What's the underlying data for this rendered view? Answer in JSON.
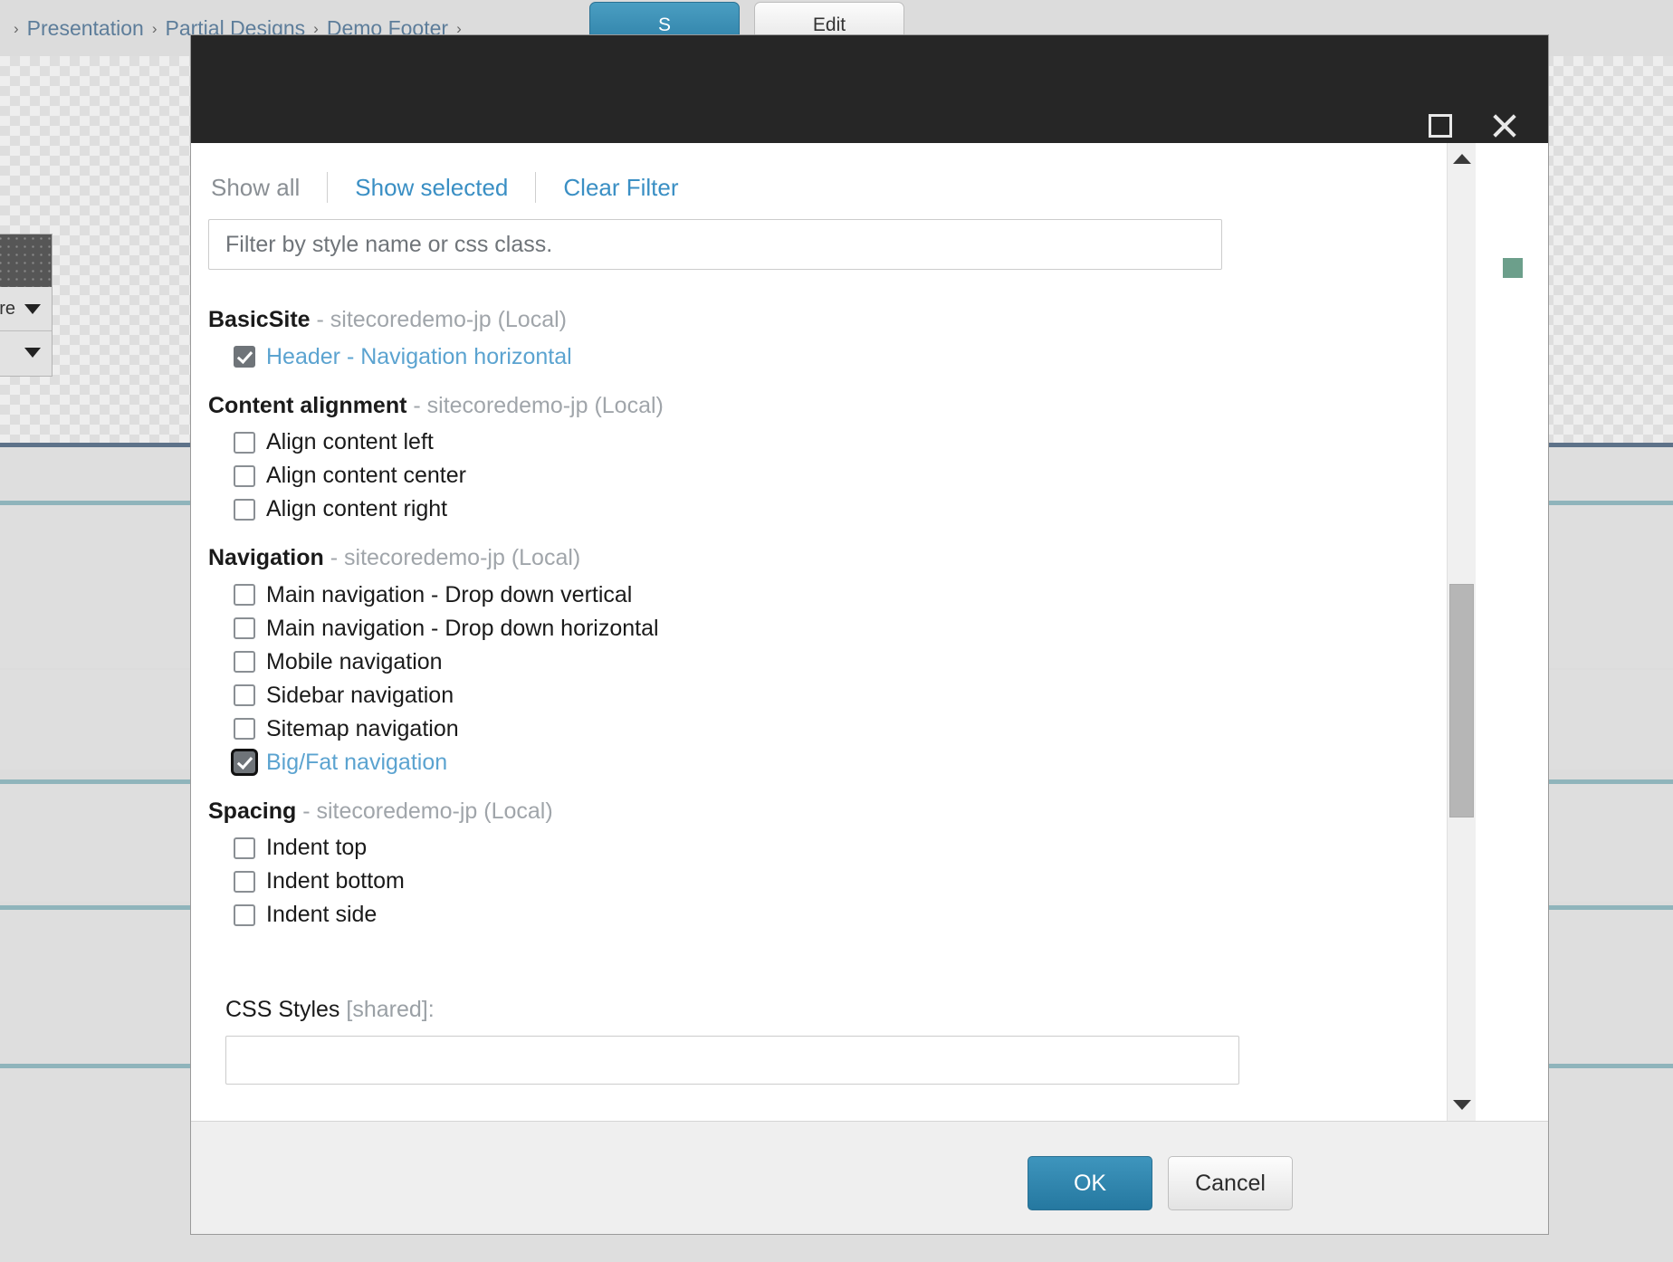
{
  "background": {
    "breadcrumb": {
      "items": [
        "Presentation",
        "Partial Designs",
        "Demo Footer"
      ],
      "separator": "›",
      "leading_separator": "›"
    },
    "buttons": {
      "save": "S",
      "edit": "Edit"
    },
    "side_panel": {
      "value_label": "re"
    }
  },
  "dialog": {
    "titlebar": {
      "maximize_icon": "maximize-icon",
      "close_icon": "close-icon"
    },
    "toolbar": {
      "show_all": "Show all",
      "show_selected": "Show selected",
      "clear_filter": "Clear Filter"
    },
    "filter": {
      "placeholder": "Filter by style name or css class.",
      "value": ""
    },
    "site_suffix": " - sitecoredemo-jp (Local)",
    "groups": [
      {
        "name": "BasicSite",
        "site": " - sitecoredemo-jp (Local)",
        "options": [
          {
            "label": "Header - Navigation horizontal",
            "checked": true,
            "focused": false
          }
        ]
      },
      {
        "name": "Content alignment",
        "site": " - sitecoredemo-jp (Local)",
        "options": [
          {
            "label": "Align content left",
            "checked": false,
            "focused": false
          },
          {
            "label": "Align content center",
            "checked": false,
            "focused": false
          },
          {
            "label": "Align content right",
            "checked": false,
            "focused": false
          }
        ]
      },
      {
        "name": "Navigation",
        "site": " - sitecoredemo-jp (Local)",
        "options": [
          {
            "label": "Main navigation - Drop down vertical",
            "checked": false,
            "focused": false
          },
          {
            "label": "Main navigation - Drop down horizontal",
            "checked": false,
            "focused": false
          },
          {
            "label": "Mobile navigation",
            "checked": false,
            "focused": false
          },
          {
            "label": "Sidebar navigation",
            "checked": false,
            "focused": false
          },
          {
            "label": "Sitemap navigation",
            "checked": false,
            "focused": false
          },
          {
            "label": "Big/Fat navigation",
            "checked": true,
            "focused": true
          }
        ]
      },
      {
        "name": "Spacing",
        "site": " - sitecoredemo-jp (Local)",
        "options": [
          {
            "label": "Indent top",
            "checked": false,
            "focused": false
          },
          {
            "label": "Indent bottom",
            "checked": false,
            "focused": false
          },
          {
            "label": "Indent side",
            "checked": false,
            "focused": false
          }
        ]
      }
    ],
    "css_styles": {
      "label": "CSS Styles",
      "shared": " [shared]:",
      "value": ""
    },
    "footer": {
      "ok": "OK",
      "cancel": "Cancel"
    },
    "scrollbar": {
      "up": "▲",
      "down": "▼"
    },
    "status_chip_color": "#6c9f8b"
  },
  "colors": {
    "accent_blue": "#3a8fc4",
    "titlebar": "#262626",
    "selected_label": "#5ba3d0",
    "green_chip": "#6c9f8b"
  }
}
